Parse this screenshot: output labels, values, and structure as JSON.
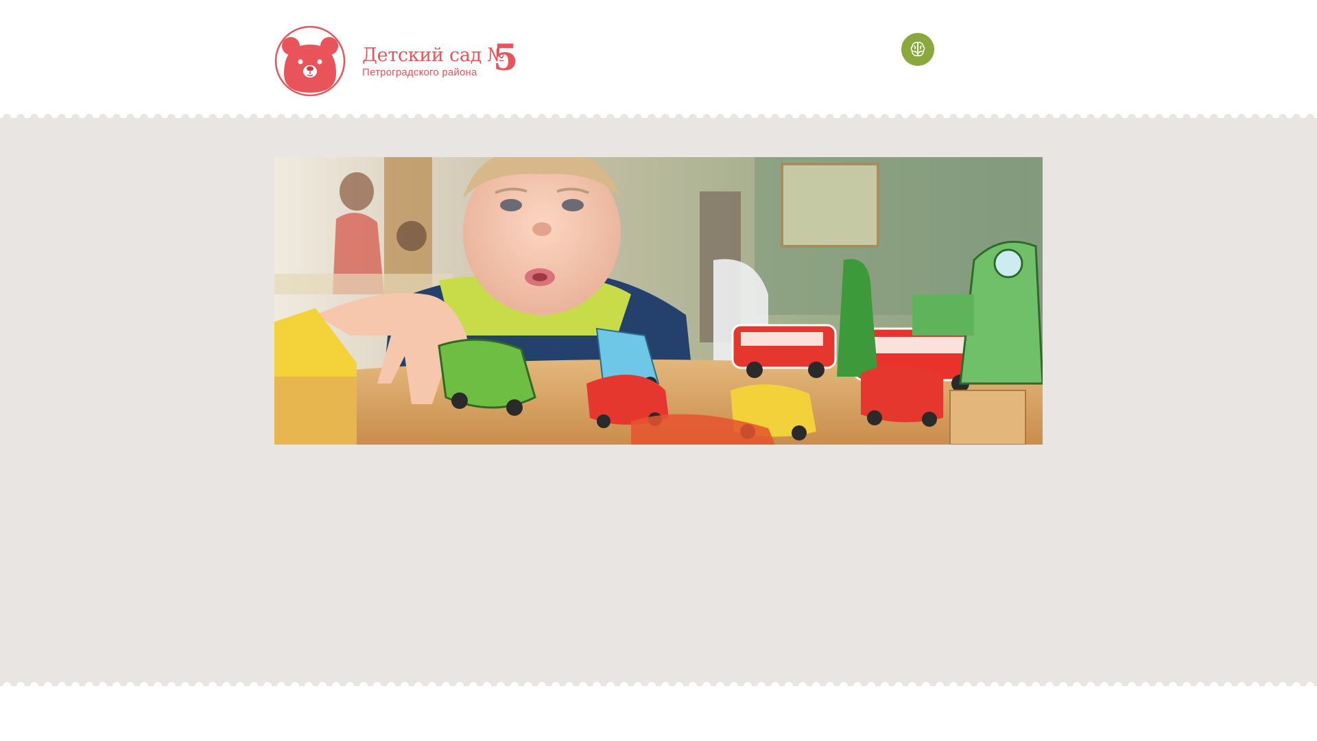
{
  "header": {
    "logo": {
      "title": "Детский сад №",
      "number": "5",
      "subtitle": "Петроградского района"
    },
    "accessibility_icon": "brain-icon"
  },
  "banner": {
    "image_subject": "child-playing-with-toy-cars-photo"
  },
  "colors": {
    "brand_red": "#e8545a",
    "accessibility_green": "#8aa83c",
    "page_gray": "#e8e5e2",
    "white": "#ffffff"
  }
}
